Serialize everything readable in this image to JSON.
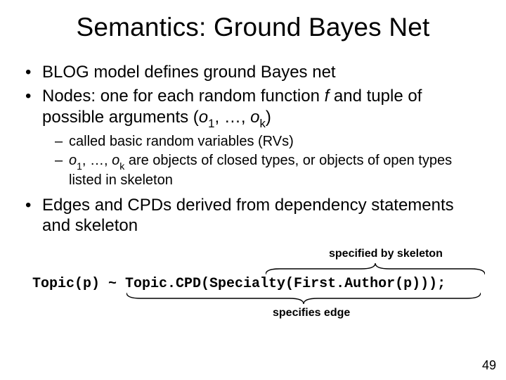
{
  "title": "Semantics: Ground Bayes Net",
  "bullets": {
    "b1": "BLOG model defines ground Bayes net",
    "b2a": "Nodes: one for each random function ",
    "b2b": "f",
    "b2c": " and tuple of possible arguments (",
    "b2_o": "o",
    "b2_1": "1",
    "b2_mid": ", …, ",
    "b2_k": "k",
    "b2_end": ")",
    "s1": "called basic random variables (RVs)",
    "s2_o": "o",
    "s2_1": "1",
    "s2_mid": ", …, ",
    "s2_k": "k",
    "s2_rest": " are objects of closed types, or objects of open types listed in skeleton",
    "b3": "Edges and CPDs derived from dependency statements and skeleton"
  },
  "anno_top": "specified by skeleton",
  "code": "Topic(p) ~ Topic.CPD(Specialty(First.Author(p)));",
  "anno_bot": "specifies edge",
  "page": "49"
}
